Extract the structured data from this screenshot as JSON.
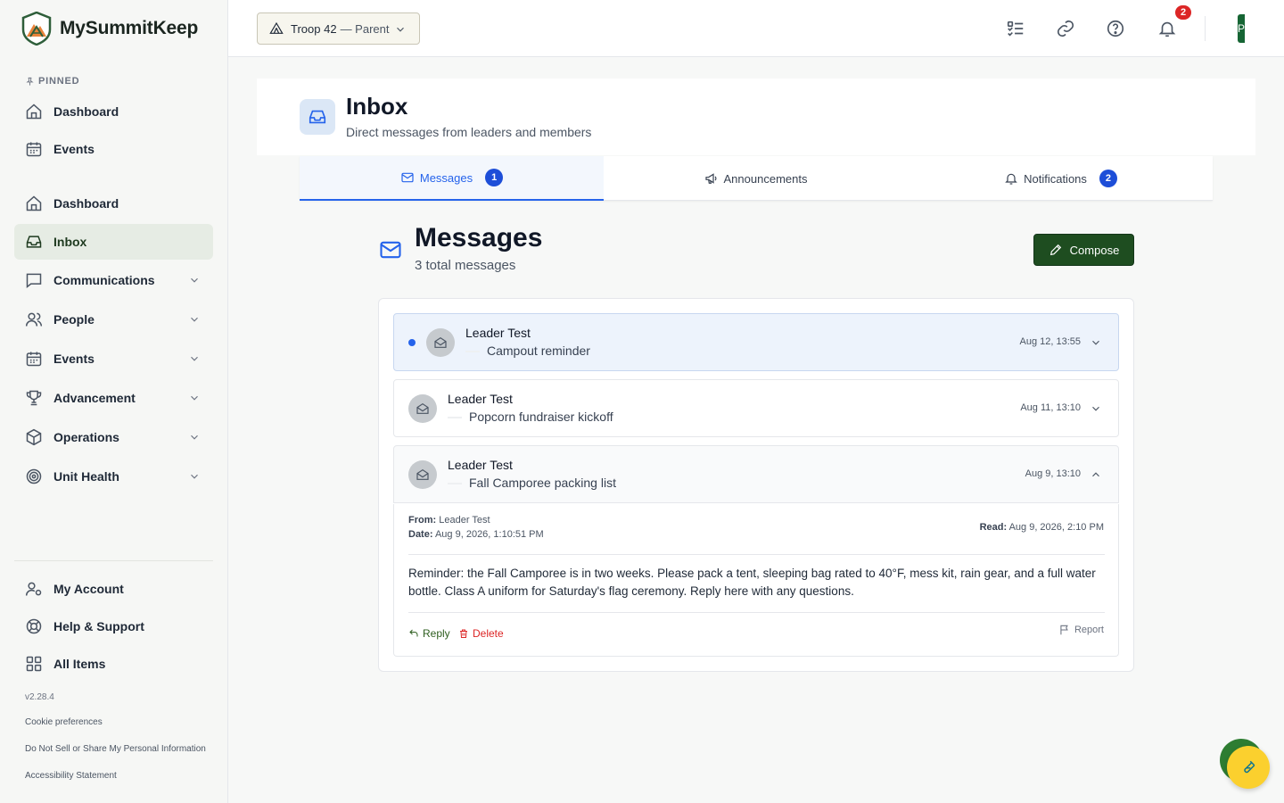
{
  "app": {
    "name": "MySummitKeep",
    "version": "v2.28.4"
  },
  "sidebar": {
    "pinned_label": "PINNED",
    "pinned": [
      {
        "label": "Dashboard",
        "icon": "home-icon"
      },
      {
        "label": "Events",
        "icon": "calendar-icon"
      }
    ],
    "items": [
      {
        "label": "Dashboard",
        "icon": "home-icon"
      },
      {
        "label": "Inbox",
        "icon": "inbox-icon",
        "active": true
      },
      {
        "label": "Communications",
        "icon": "chat-icon"
      },
      {
        "label": "People",
        "icon": "people-icon"
      },
      {
        "label": "Events",
        "icon": "calendar-icon"
      },
      {
        "label": "Advancement",
        "icon": "trophy-icon"
      },
      {
        "label": "Operations",
        "icon": "box-icon"
      },
      {
        "label": "Unit Health",
        "icon": "target-icon"
      }
    ],
    "bottom": [
      {
        "label": "My Account",
        "icon": "user-gear-icon"
      },
      {
        "label": "Help & Support",
        "icon": "lifebuoy-icon"
      },
      {
        "label": "All Items",
        "icon": "grid-icon"
      }
    ],
    "footer_links": [
      "Cookie preferences",
      "Do Not Sell or Share My Personal Information",
      "Accessibility Statement"
    ]
  },
  "topbar": {
    "unit": "Troop 42",
    "role": "— Parent",
    "notification_count": "2",
    "avatar_initial": "P"
  },
  "page": {
    "title": "Inbox",
    "subtitle": "Direct messages from leaders and members"
  },
  "tabs": [
    {
      "label": "Messages",
      "badge": "1",
      "active": true
    },
    {
      "label": "Announcements",
      "badge": ""
    },
    {
      "label": "Notifications",
      "badge": "2"
    }
  ],
  "messages": {
    "title": "Messages",
    "count_text": "3 total messages",
    "compose_label": "Compose",
    "items": [
      {
        "sender": "Leader Test",
        "subject": "Campout reminder",
        "time": "Aug 12, 13:55",
        "unread": true
      },
      {
        "sender": "Leader Test",
        "subject": "Popcorn fundraiser kickoff",
        "time": "Aug 11, 13:10",
        "unread": false
      },
      {
        "sender": "Leader Test",
        "subject": "Fall Camporee packing list",
        "time": "Aug 9, 13:10",
        "unread": false,
        "expanded": true
      }
    ],
    "detail": {
      "from_label": "From:",
      "from": "Leader Test",
      "date_label": "Date:",
      "date": "Aug 9, 2026, 1:10:51 PM",
      "read_label": "Read:",
      "read": "Aug 9, 2026, 2:10 PM",
      "body": "Reminder: the Fall Camporee is in two weeks. Please pack a tent, sleeping bag rated to 40°F, mess kit, rain gear, and a full water bottle. Class A uniform for Saturday's flag ceremony. Reply here with any questions.",
      "reply_label": "Reply",
      "delete_label": "Delete",
      "report_label": "Report"
    }
  },
  "colors": {
    "brand_green": "#1e4d20",
    "accent_blue": "#2563eb",
    "badge_red": "#dc2626",
    "fab_yellow": "#fbd02e"
  }
}
